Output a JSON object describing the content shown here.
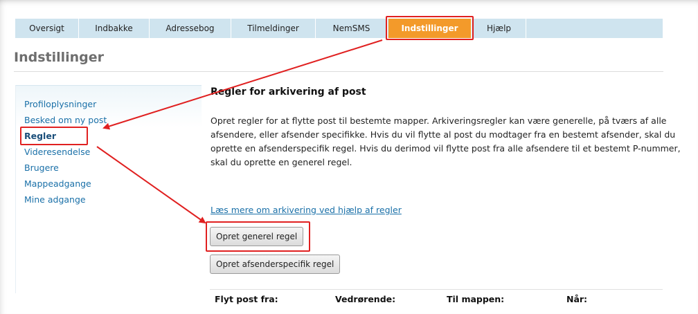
{
  "tabs": [
    {
      "label": "Oversigt"
    },
    {
      "label": "Indbakke"
    },
    {
      "label": "Adressebog"
    },
    {
      "label": "Tilmeldinger"
    },
    {
      "label": "NemSMS"
    },
    {
      "label": "Indstillinger",
      "active": true
    },
    {
      "label": "Hjælp"
    }
  ],
  "page": {
    "title": "Indstillinger"
  },
  "sidebar": {
    "items": [
      {
        "label": "Profiloplysninger"
      },
      {
        "label": "Besked om ny post"
      },
      {
        "label": "Regler",
        "current": true
      },
      {
        "label": "Videresendelse"
      },
      {
        "label": "Brugere"
      },
      {
        "label": "Mappeadgange"
      },
      {
        "label": "Mine adgange"
      }
    ]
  },
  "content": {
    "title": "Regler for arkivering af post",
    "description": "Opret regler for at flytte post til bestemte mapper. Arkiveringsregler kan være generelle, på tværs af alle afsendere, eller afsender specifikke. Hvis du vil flytte al post du modtager fra en bestemt afsender, skal du oprette en afsenderspecifik regel. Hvis du derimod vil flytte post fra alle afsendere til et bestemt P-nummer, skal du oprette en generel regel.",
    "link": "Læs mere om arkivering ved hjælp af regler",
    "buttons": {
      "general": "Opret generel regel",
      "specific": "Opret afsenderspecifik regel"
    },
    "table_headers": [
      "Flyt post fra:",
      "Vedrørende:",
      "Til mappen:",
      "Når:"
    ]
  },
  "colors": {
    "tab_bg": "#cfe4ef",
    "tab_active": "#f39a2a",
    "link": "#1a70a8",
    "highlight": "#e02020"
  }
}
